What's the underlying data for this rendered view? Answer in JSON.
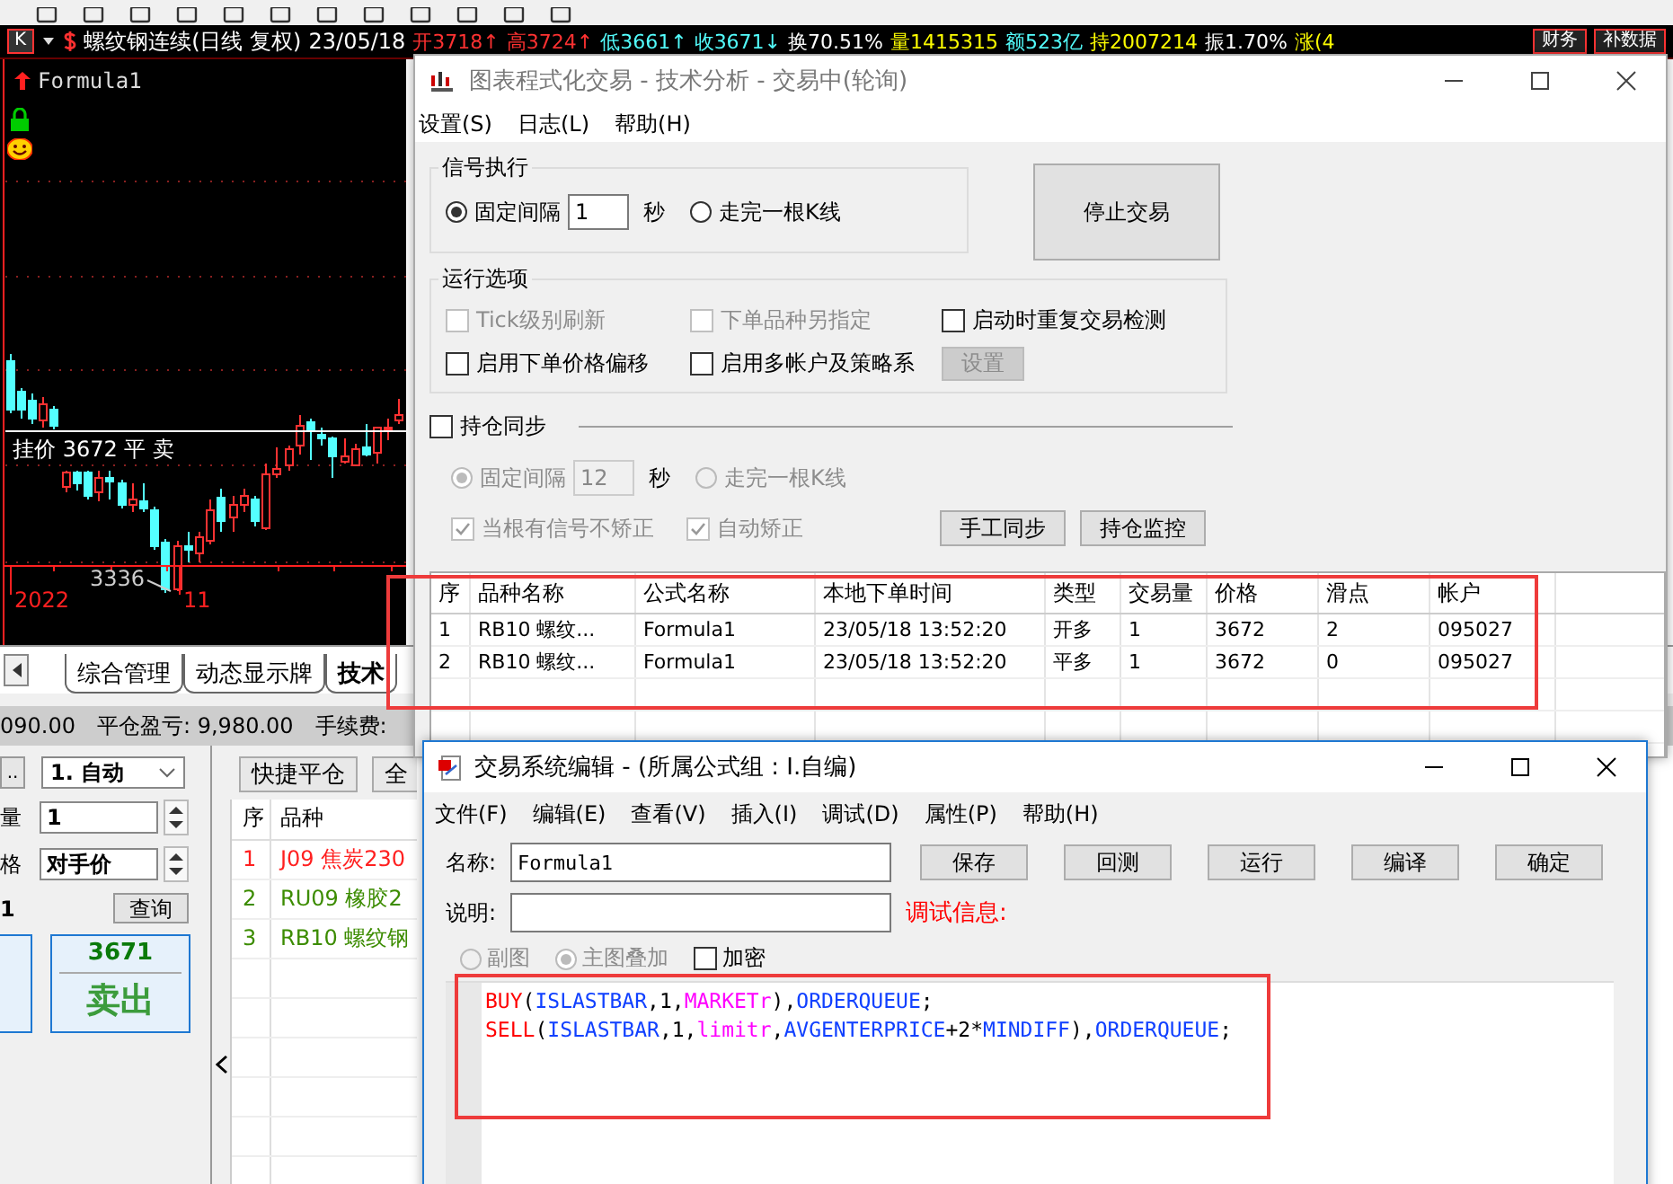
{
  "quote_bar": {
    "chart_type": "K",
    "symbol": "螺纹钢连续(日线 复权)",
    "date": "23/05/18",
    "fields": [
      {
        "text": "开3718↑",
        "color": "#ff3232"
      },
      {
        "text": "高3724↑",
        "color": "#ff3232"
      },
      {
        "text": "低3661↑",
        "color": "#54ffff"
      },
      {
        "text": "收3671↓",
        "color": "#54ffff"
      },
      {
        "text": "换70.51%",
        "color": "#ffffff"
      },
      {
        "text": "量1415315",
        "color": "#ffff00"
      },
      {
        "text": "额523亿",
        "color": "#54ffff"
      },
      {
        "text": "持2007214",
        "color": "#ffff00"
      },
      {
        "text": "振1.70%",
        "color": "#ffffff"
      },
      {
        "text": "涨(4",
        "color": "#ffff00"
      }
    ],
    "buttons": [
      "财务",
      "补数据"
    ]
  },
  "chart": {
    "indicator": "Formula1",
    "order_line": "挂价 3672 平 卖",
    "low_label": "3336",
    "x_labels": [
      "2022",
      "11"
    ]
  },
  "tabs": [
    {
      "label": "综合管理",
      "selected": false
    },
    {
      "label": "动态显示牌",
      "selected": false
    },
    {
      "label": "技术",
      "selected": true
    }
  ],
  "account_bar": [
    "090.00",
    "平仓盈亏: 9,980.00",
    "手续费:"
  ],
  "order_panel": {
    "more_button": "..",
    "mode_select": "1. 自动",
    "qty_label": "量",
    "qty_value": "1",
    "price_label": "格",
    "price_value": "对手价",
    "info": "1",
    "query_button": "查询",
    "sell_price": "3671",
    "sell_label": "卖出"
  },
  "position_list": {
    "buttons": [
      "快捷平仓",
      "全"
    ],
    "columns": [
      "序",
      "品种"
    ],
    "rows": [
      {
        "index": "1",
        "name": "J09 焦炭230",
        "color": "#ff2020"
      },
      {
        "index": "2",
        "name": "RU09 橡胶2",
        "color": "#3c8c00"
      },
      {
        "index": "3",
        "name": "RB10 螺纹钢",
        "color": "#3c8c00"
      }
    ]
  },
  "trade_window": {
    "title": "图表程式化交易 - 技术分析 - 交易中(轮询)",
    "menu": [
      "设置(S)",
      "日志(L)",
      "帮助(H)"
    ],
    "signal_group": {
      "title": "信号执行",
      "options": [
        {
          "kind": "interval",
          "label": "固定间隔",
          "selected": true,
          "value": "1",
          "unit": "秒"
        },
        {
          "kind": "plain",
          "label": "走完一根K线",
          "selected": false
        }
      ]
    },
    "stop_button": "停止交易",
    "run_group": {
      "title": "运行选项",
      "items": [
        {
          "kind": "checkbox",
          "label": "Tick级别刷新",
          "checked": false,
          "disabled": true
        },
        {
          "kind": "checkbox",
          "label": "下单品种另指定",
          "checked": false,
          "disabled": true
        },
        {
          "kind": "checkbox",
          "label": "启动时重复交易检测",
          "checked": false,
          "disabled": false
        },
        {
          "kind": "checkbox",
          "label": "启用下单价格偏移",
          "checked": false,
          "disabled": false
        },
        {
          "kind": "checkbox",
          "label": "启用多帐户及策略系",
          "checked": false,
          "disabled": false
        },
        {
          "kind": "button",
          "label": "设置",
          "disabled": true
        }
      ]
    },
    "sync": {
      "label": "持仓同步",
      "checked": false,
      "options": [
        {
          "kind": "interval",
          "label": "固定间隔",
          "selected": true,
          "disabled": true,
          "value": "12",
          "unit": "秒"
        },
        {
          "kind": "plain",
          "label": "走完一根K线",
          "selected": false,
          "disabled": true
        }
      ],
      "checks": [
        {
          "label": "当根有信号不矫正",
          "checked": true,
          "disabled": true
        },
        {
          "label": "自动矫正",
          "checked": true,
          "disabled": true
        }
      ],
      "buttons": [
        "手工同步",
        "持仓监控"
      ]
    },
    "orders": {
      "columns": [
        "序",
        "品种名称",
        "公式名称",
        "本地下单时间",
        "类型",
        "交易量",
        "价格",
        "滑点",
        "帐户"
      ],
      "rows": [
        [
          "1",
          "RB10 螺纹...",
          "Formula1",
          "23/05/18 13:52:20",
          "开多",
          "1",
          "3672",
          "2",
          "095027"
        ],
        [
          "2",
          "RB10 螺纹...",
          "Formula1",
          "23/05/18 13:52:20",
          "平多",
          "1",
          "3672",
          "0",
          "095027"
        ]
      ]
    }
  },
  "editor_window": {
    "title": "交易系统编辑 - (所属公式组 : I.自编)",
    "menu": [
      "文件(F)",
      "编辑(E)",
      "查看(V)",
      "插入(I)",
      "调试(D)",
      "属性(P)",
      "帮助(H)"
    ],
    "name_label": "名称:",
    "name_value": "Formula1",
    "desc_label": "说明:",
    "buttons": [
      "保存",
      "回测",
      "运行",
      "编译",
      "确定"
    ],
    "debug_label": "调试信息:",
    "options": [
      {
        "kind": "radio",
        "label": "副图",
        "selected": false,
        "disabled": true
      },
      {
        "kind": "radio",
        "label": "主图叠加",
        "selected": true,
        "disabled": true
      },
      {
        "kind": "checkbox",
        "label": "加密",
        "checked": false,
        "disabled": false
      }
    ],
    "code": [
      [
        {
          "text": "BUY",
          "kind": "function"
        },
        {
          "text": "(",
          "kind": "plain"
        },
        {
          "text": "ISLASTBAR",
          "kind": "system"
        },
        {
          "text": ",1,",
          "kind": "plain"
        },
        {
          "text": "MARKETr",
          "kind": "param"
        },
        {
          "text": "),",
          "kind": "plain"
        },
        {
          "text": "ORDERQUEUE",
          "kind": "system"
        },
        {
          "text": ";",
          "kind": "plain"
        }
      ],
      [
        {
          "text": "SELL",
          "kind": "function"
        },
        {
          "text": "(",
          "kind": "plain"
        },
        {
          "text": "ISLASTBAR",
          "kind": "system"
        },
        {
          "text": ",1,",
          "kind": "plain"
        },
        {
          "text": "limitr",
          "kind": "param"
        },
        {
          "text": ",",
          "kind": "plain"
        },
        {
          "text": "AVGENTERPRICE",
          "kind": "system"
        },
        {
          "text": "+2*",
          "kind": "plain"
        },
        {
          "text": "MINDIFF",
          "kind": "system"
        },
        {
          "text": "),",
          "kind": "plain"
        },
        {
          "text": "ORDERQUEUE",
          "kind": "system"
        },
        {
          "text": ";",
          "kind": "plain"
        }
      ]
    ]
  }
}
